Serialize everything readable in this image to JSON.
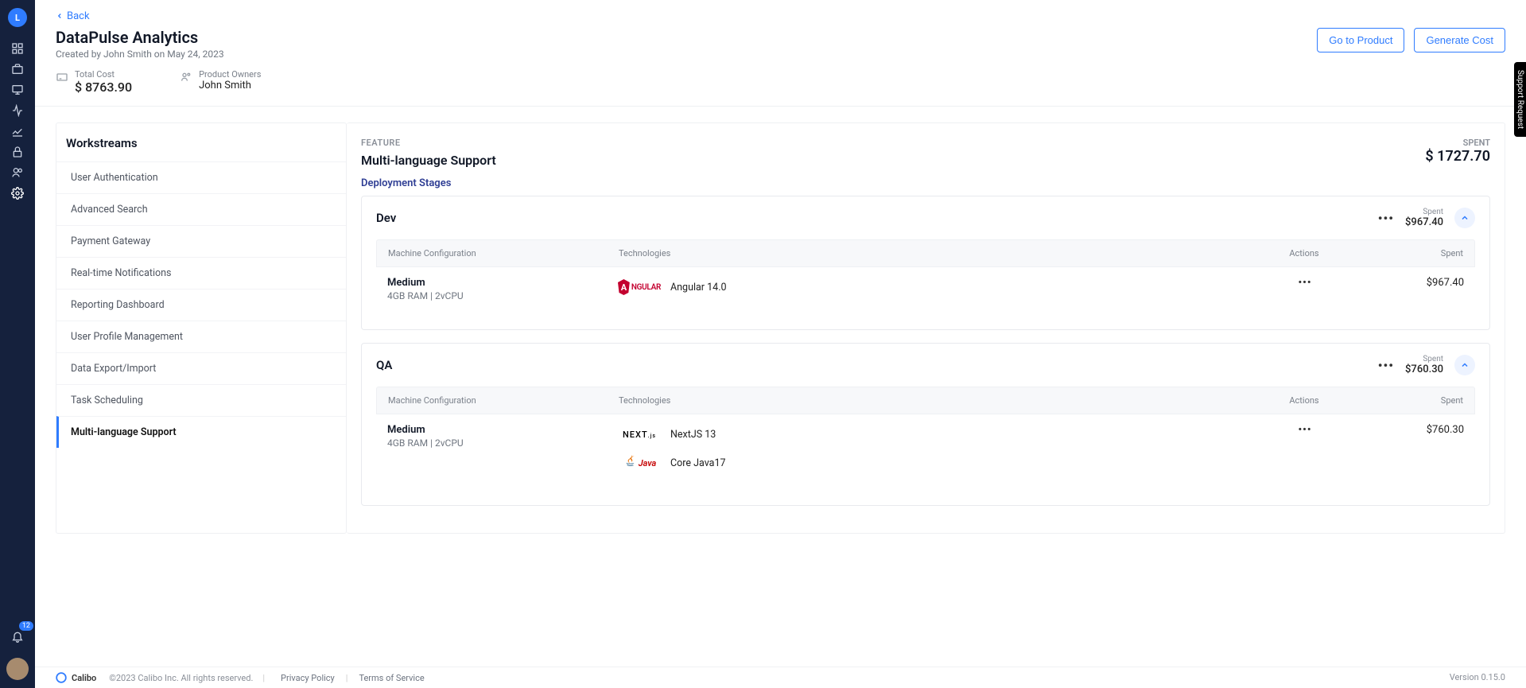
{
  "nav": {
    "logo_letter": "L",
    "notification_count": "12"
  },
  "header": {
    "back_label": "Back",
    "product_title": "DataPulse Analytics",
    "created_line": "Created by John Smith on May 24, 2023",
    "go_to_product": "Go to Product",
    "generate_cost": "Generate Cost",
    "total_cost_label": "Total Cost",
    "total_cost_value": "$ 8763.90",
    "product_owners_label": "Product Owners",
    "product_owner_name": "John Smith"
  },
  "workstreams": {
    "title": "Workstreams",
    "items": [
      {
        "label": "User Authentication",
        "active": false
      },
      {
        "label": "Advanced Search",
        "active": false
      },
      {
        "label": "Payment Gateway",
        "active": false
      },
      {
        "label": "Real-time Notifications",
        "active": false
      },
      {
        "label": "Reporting Dashboard",
        "active": false
      },
      {
        "label": "User Profile Management",
        "active": false
      },
      {
        "label": "Data Export/Import",
        "active": false
      },
      {
        "label": "Task Scheduling",
        "active": false
      },
      {
        "label": "Multi-language Support",
        "active": true
      }
    ]
  },
  "feature": {
    "label": "FEATURE",
    "title": "Multi-language Support",
    "spent_label": "SPENT",
    "spent_value": "$ 1727.70",
    "deploy_title": "Deployment Stages"
  },
  "table": {
    "col_mc": "Machine Configuration",
    "col_tech": "Technologies",
    "col_act": "Actions",
    "col_sp": "Spent"
  },
  "stages": [
    {
      "name": "Dev",
      "spent_label": "Spent",
      "spent_value": "$967.40",
      "machine": {
        "name": "Medium",
        "spec": "4GB RAM | 2vCPU"
      },
      "technologies": [
        {
          "logo": "angular",
          "version": "Angular 14.0"
        }
      ],
      "row_spent": "$967.40"
    },
    {
      "name": "QA",
      "spent_label": "Spent",
      "spent_value": "$760.30",
      "machine": {
        "name": "Medium",
        "spec": "4GB RAM | 2vCPU"
      },
      "technologies": [
        {
          "logo": "nextjs",
          "version": "NextJS 13"
        },
        {
          "logo": "java",
          "version": "Core Java17"
        }
      ],
      "row_spent": "$760.30"
    }
  ],
  "footer": {
    "brand": "Calibo",
    "copyright": "©2023 Calibo Inc. All rights reserved.",
    "privacy": "Privacy Policy",
    "terms": "Terms of Service",
    "version": "Version 0.15.0"
  },
  "support_tab": "Support Request"
}
